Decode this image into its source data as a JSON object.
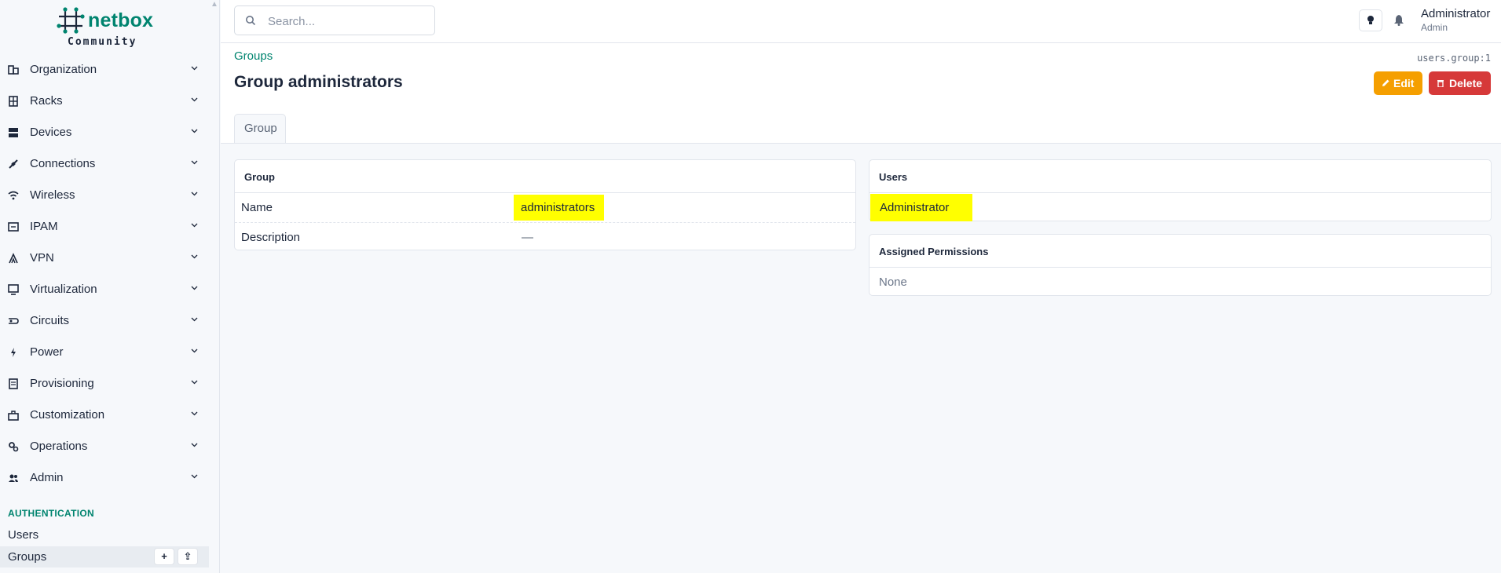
{
  "brand": {
    "name": "netbox",
    "edition": "Community",
    "color": "#00846f"
  },
  "sidebar": {
    "items": [
      {
        "label": "Organization",
        "icon": "domain-icon"
      },
      {
        "label": "Racks",
        "icon": "rack-icon"
      },
      {
        "label": "Devices",
        "icon": "server-icon"
      },
      {
        "label": "Connections",
        "icon": "cable-icon"
      },
      {
        "label": "Wireless",
        "icon": "wifi-icon"
      },
      {
        "label": "IPAM",
        "icon": "counter-icon"
      },
      {
        "label": "VPN",
        "icon": "tunnel-icon"
      },
      {
        "label": "Virtualization",
        "icon": "monitor-icon"
      },
      {
        "label": "Circuits",
        "icon": "transit-icon"
      },
      {
        "label": "Power",
        "icon": "flash-icon"
      },
      {
        "label": "Provisioning",
        "icon": "file-document-icon"
      },
      {
        "label": "Customization",
        "icon": "toolbox-icon"
      },
      {
        "label": "Operations",
        "icon": "cogs-icon"
      },
      {
        "label": "Admin",
        "icon": "account-multiple-icon"
      }
    ],
    "section": "AUTHENTICATION",
    "sub_items": {
      "users": "Users",
      "groups": "Groups",
      "add": "+",
      "import": "⇪"
    }
  },
  "topbar": {
    "search_placeholder": "Search...",
    "user": {
      "name": "Administrator",
      "role": "Admin"
    }
  },
  "page": {
    "breadcrumb": "Groups",
    "object_id": "users.group:1",
    "title": "Group administrators",
    "edit_label": "Edit",
    "delete_label": "Delete",
    "tab": "Group"
  },
  "group_card": {
    "title": "Group",
    "rows": [
      {
        "key": "Name",
        "value": "administrators"
      },
      {
        "key": "Description",
        "value": "—"
      }
    ]
  },
  "users_card": {
    "title": "Users",
    "users": [
      "Administrator"
    ]
  },
  "permissions_card": {
    "title": "Assigned Permissions",
    "empty": "None"
  },
  "colors": {
    "accent": "#00846f",
    "edit": "#f59f00",
    "delete": "#d63939",
    "highlight": "#ffff00"
  }
}
